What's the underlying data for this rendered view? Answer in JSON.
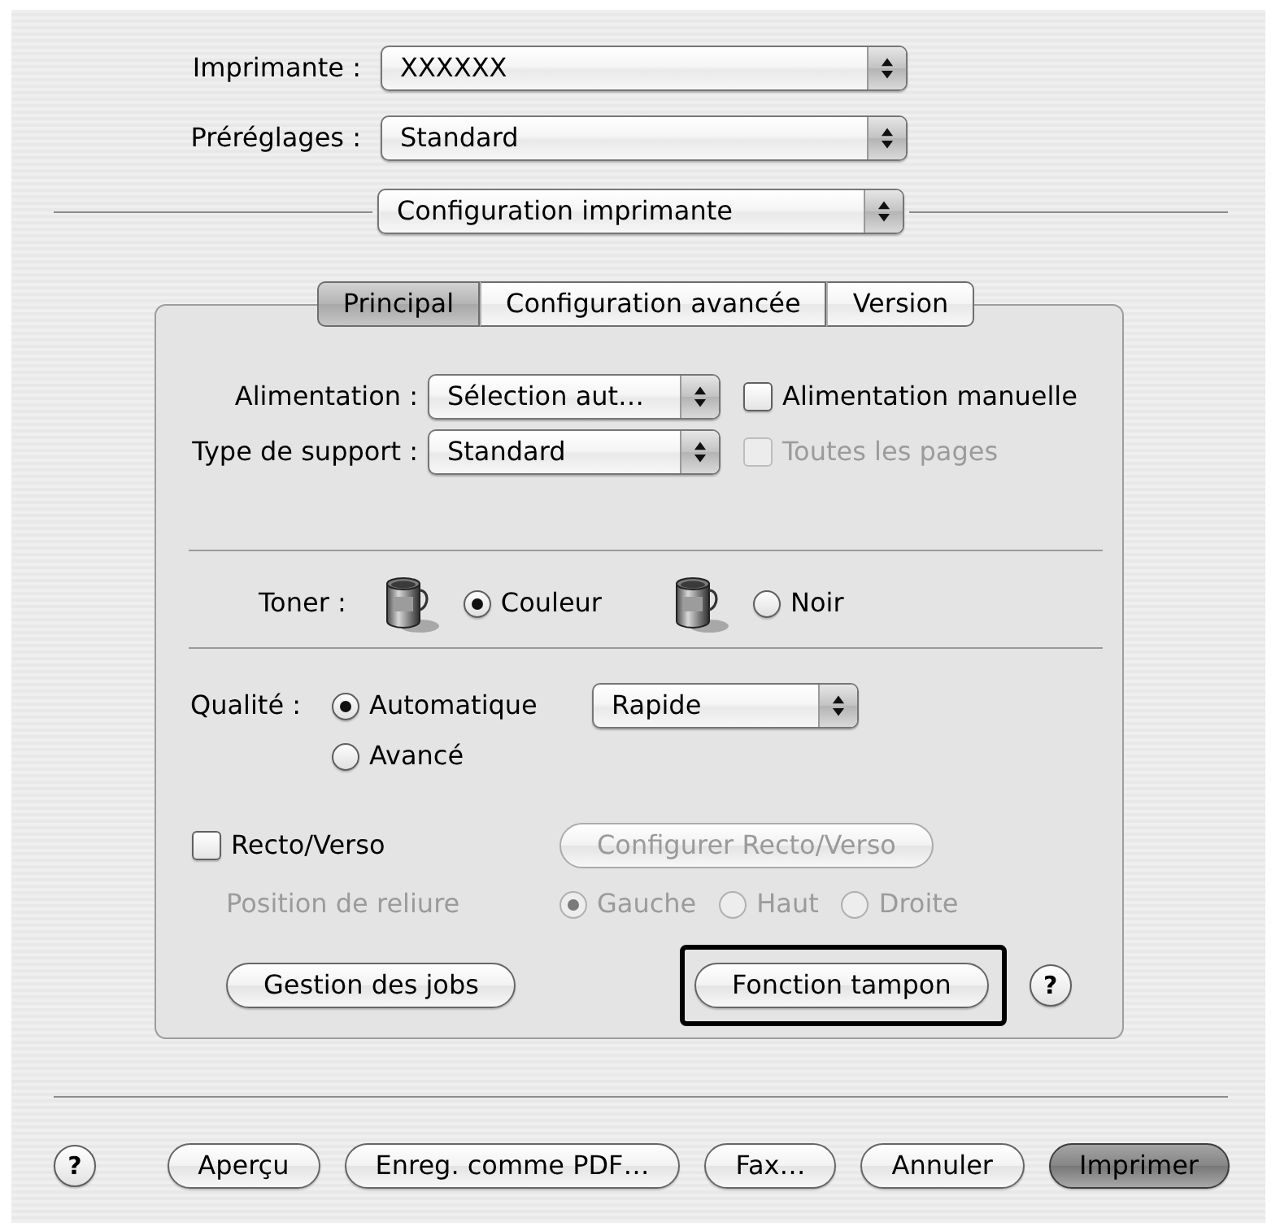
{
  "print_settings": [
    {
      "label": "Imprimante :",
      "value": "XXXXXX"
    },
    {
      "label": "Préréglages :",
      "value": "Standard"
    }
  ],
  "pane_selector": {
    "value": "Configuration imprimante"
  },
  "tabs": [
    {
      "label": "Principal",
      "selected": true
    },
    {
      "label": "Configuration avancée",
      "selected": false
    },
    {
      "label": "Version",
      "selected": false
    }
  ],
  "paper_options": [
    {
      "label": "Alimentation :",
      "value": "Sélection aut…",
      "option": {
        "label": "Alimentation manuelle",
        "checked": false,
        "disabled": false
      }
    },
    {
      "label": "Type de support :",
      "value": "Standard",
      "option": {
        "label": "Toutes les pages",
        "checked": false,
        "disabled": true
      }
    }
  ],
  "toner": {
    "label": "Toner :",
    "choices": [
      {
        "label": "Couleur",
        "selected": true
      },
      {
        "label": "Noir",
        "selected": false
      }
    ]
  },
  "quality": {
    "label": "Qualité :",
    "choices": [
      {
        "label": "Automatique",
        "selected": true
      },
      {
        "label": "Avancé",
        "selected": false
      }
    ],
    "speed": {
      "value": "Rapide"
    }
  },
  "duplex": {
    "label": "Recto/Verso",
    "checked": false,
    "configure_button": {
      "label": "Configurer Recto/Verso",
      "disabled": true
    },
    "binding": {
      "label": "Position de reliure",
      "disabled": true,
      "choices": [
        {
          "label": "Gauche",
          "selected": true
        },
        {
          "label": "Haut",
          "selected": false
        },
        {
          "label": "Droite",
          "selected": false
        }
      ]
    }
  },
  "panel_buttons": [
    {
      "label": "Gestion des jobs",
      "highlighted": false
    },
    {
      "label": "Fonction tampon",
      "highlighted": true
    }
  ],
  "panel_help": {
    "label": "?"
  },
  "footer_help": {
    "label": "?"
  },
  "footer_buttons": [
    {
      "label": "Aperçu",
      "default": false
    },
    {
      "label": "Enreg. comme PDF…",
      "default": false
    },
    {
      "label": "Fax…",
      "default": false
    },
    {
      "label": "Annuler",
      "default": false
    },
    {
      "label": "Imprimer",
      "default": true
    }
  ]
}
